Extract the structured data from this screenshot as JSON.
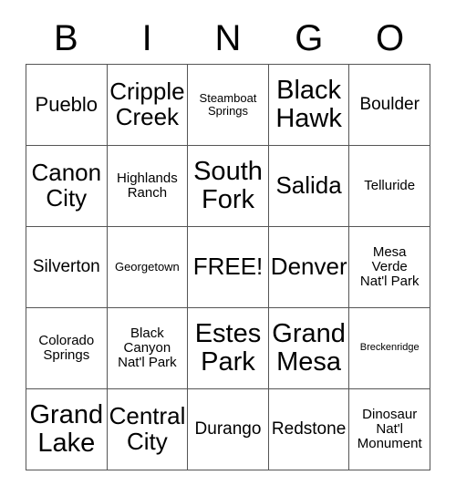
{
  "card": {
    "title": "BINGO",
    "free_space_label": "FREE!",
    "colors": {
      "text": "#000000",
      "grid_line": "#555555",
      "background": "#ffffff"
    }
  },
  "header": {
    "letters": [
      "B",
      "I",
      "N",
      "G",
      "O"
    ]
  },
  "grid": {
    "rows": 5,
    "columns": 5,
    "cells": [
      {
        "text": "Pueblo",
        "size": "lg",
        "free": false
      },
      {
        "text": "Cripple\nCreek",
        "size": "xl",
        "free": false
      },
      {
        "text": "Steamboat\nSprings",
        "size": "xs",
        "free": false
      },
      {
        "text": "Black\nHawk",
        "size": "xxl",
        "free": false
      },
      {
        "text": "Boulder",
        "size": "md",
        "free": false
      },
      {
        "text": "Canon\nCity",
        "size": "xl",
        "free": false
      },
      {
        "text": "Highlands\nRanch",
        "size": "sm",
        "free": false
      },
      {
        "text": "South\nFork",
        "size": "xxl",
        "free": false
      },
      {
        "text": "Salida",
        "size": "xl",
        "free": false
      },
      {
        "text": "Telluride",
        "size": "sm",
        "free": false
      },
      {
        "text": "Silverton",
        "size": "md",
        "free": false
      },
      {
        "text": "Georgetown",
        "size": "xs",
        "free": false
      },
      {
        "text": "FREE!",
        "size": "xl",
        "free": true
      },
      {
        "text": "Denver",
        "size": "xl",
        "free": false
      },
      {
        "text": "Mesa\nVerde\nNat'l Park",
        "size": "sm",
        "free": false
      },
      {
        "text": "Colorado\nSprings",
        "size": "sm",
        "free": false
      },
      {
        "text": "Black\nCanyon\nNat'l Park",
        "size": "sm",
        "free": false
      },
      {
        "text": "Estes\nPark",
        "size": "xxl",
        "free": false
      },
      {
        "text": "Grand\nMesa",
        "size": "xxl",
        "free": false
      },
      {
        "text": "Breckenridge",
        "size": "xxs",
        "free": false
      },
      {
        "text": "Grand\nLake",
        "size": "xxl",
        "free": false
      },
      {
        "text": "Central\nCity",
        "size": "xl",
        "free": false
      },
      {
        "text": "Durango",
        "size": "md",
        "free": false
      },
      {
        "text": "Redstone",
        "size": "md",
        "free": false
      },
      {
        "text": "Dinosaur\nNat'l\nMonument",
        "size": "sm",
        "free": false
      }
    ]
  }
}
